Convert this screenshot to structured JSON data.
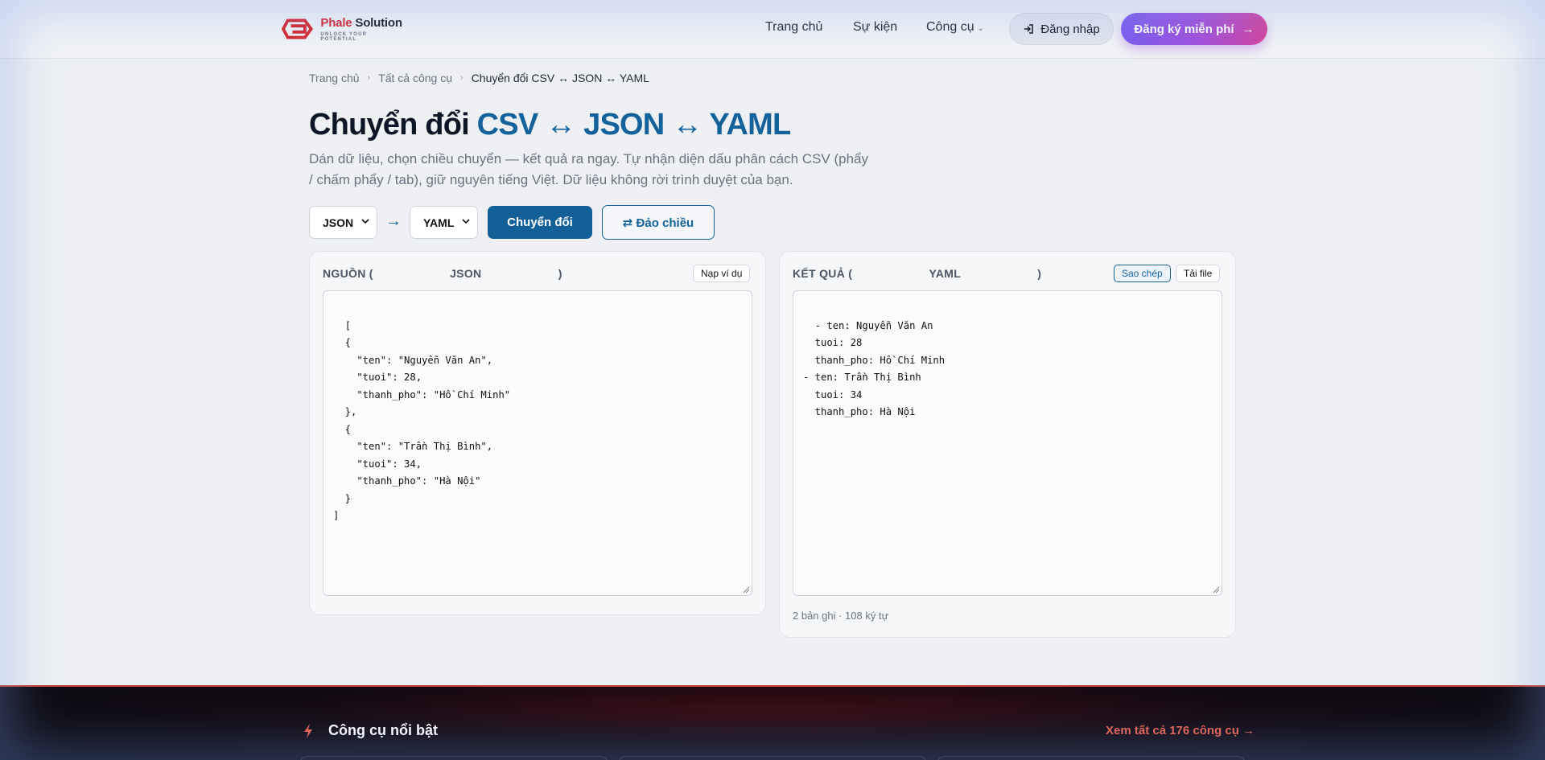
{
  "header": {
    "logo_name_red": "Phale",
    "logo_name_rest": " Solution",
    "logo_tagline": "UNLOCK YOUR POTENTIAL",
    "nav": [
      {
        "label": "Trang chủ"
      },
      {
        "label": "Sự kiện"
      },
      {
        "label": "Công cụ"
      }
    ],
    "login_label": "Đăng nhập",
    "signup_label": "Đăng ký miễn phí",
    "signup_color": "#a34fd9"
  },
  "breadcrumb": [
    "Trang chủ",
    "Tất cả công cụ",
    "Chuyển đổi CSV ↔ JSON ↔ YAML"
  ],
  "page": {
    "title_plain": "Chuyển đổi ",
    "title_accent": "CSV ↔ JSON ↔ YAML",
    "accent_color": "#14629b",
    "description": "Dán dữ liệu, chọn chiều chuyển — kết quả ra ngay. Tự nhận diện dấu phân cách CSV (phẩy / chấm phẩy / tab), giữ nguyên tiếng Việt. Dữ liệu không rời trình duyệt của bạn."
  },
  "controls": {
    "from_format": "JSON",
    "to_format": "YAML",
    "arrow": "→",
    "convert_label": "Chuyển đổi",
    "swap_label": "⇄ Đảo chiều"
  },
  "source": {
    "label_prefix": "NGUỒN (",
    "label_format": "JSON",
    "label_suffix": ")",
    "sample_button": "Nạp ví dụ",
    "content": "[\n  {\n    \"ten\": \"Nguyễn Văn An\",\n    \"tuoi\": 28,\n    \"thanh_pho\": \"Hồ Chí Minh\"\n  },\n  {\n    \"ten\": \"Trần Thị Bình\",\n    \"tuoi\": 34,\n    \"thanh_pho\": \"Hà Nội\"\n  }\n]"
  },
  "result": {
    "label_prefix": "KẾT QUẢ (",
    "label_format": "YAML",
    "label_suffix": ")",
    "copy_button": "Sao chép",
    "download_button": "Tải file",
    "content": "- ten: Nguyễn Văn An\n  tuoi: 28\n  thanh_pho: Hồ Chí Minh\n- ten: Trần Thị Bình\n  tuoi: 34\n  thanh_pho: Hà Nội",
    "stats": "2 bản ghi · 108 ký tự"
  },
  "footer": {
    "section_title": "Công cụ nổi bật",
    "view_all_link": "Xem tất cả 176 công cụ →"
  }
}
